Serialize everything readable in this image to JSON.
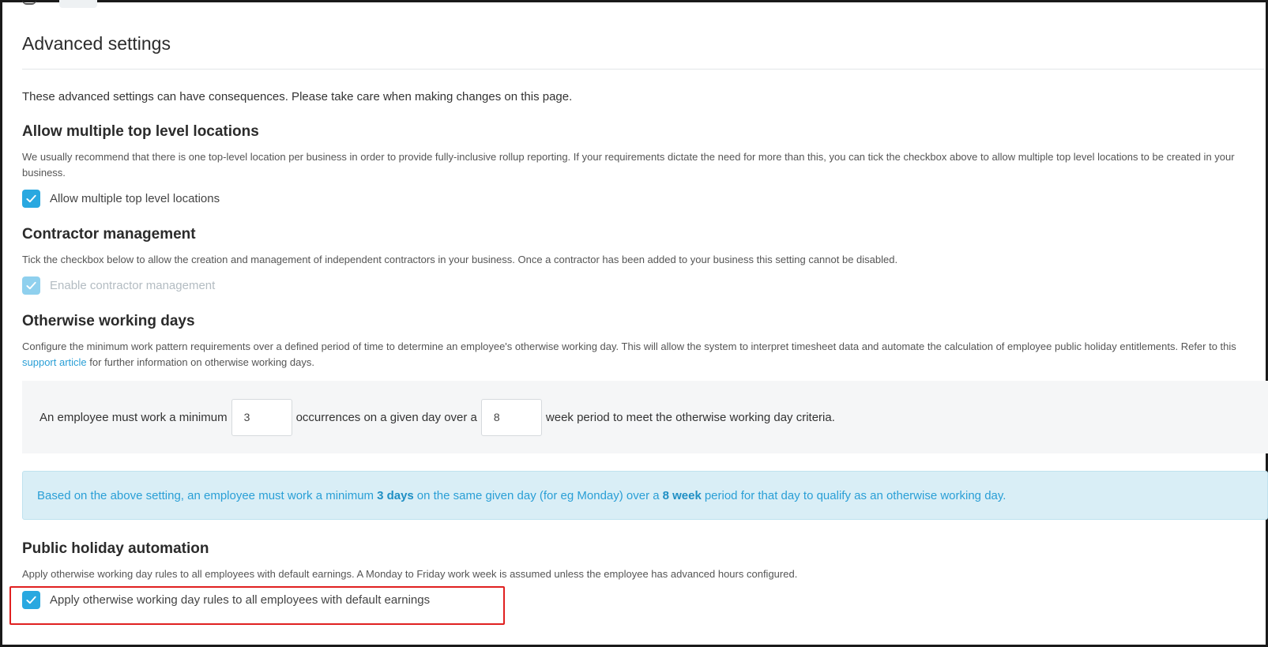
{
  "page": {
    "title": "Advanced settings",
    "warning": "These advanced settings can have consequences. Please take care when making changes on this page."
  },
  "sections": {
    "top_level": {
      "title": "Allow multiple top level locations",
      "description": "We usually recommend that there is one top-level location per business in order to provide fully-inclusive rollup reporting. If your requirements dictate the need for more than this, you can tick the checkbox above to allow multiple top level locations to be created in your business.",
      "checkbox_label": "Allow multiple top level locations",
      "checked": true
    },
    "contractor": {
      "title": "Contractor management",
      "description": "Tick the checkbox below to allow the creation and management of independent contractors in your business. Once a contractor has been added to your business this setting cannot be disabled.",
      "checkbox_label": "Enable contractor management",
      "checked": true,
      "disabled": true
    },
    "working_days": {
      "title": "Otherwise working days",
      "description_before_link": "Configure the minimum work pattern requirements over a defined period of time to determine an employee's otherwise working day. This will allow the system to interpret timesheet data and automate the calculation of employee public holiday entitlements. Refer to this",
      "link_text": "support article",
      "description_after_link": "for further information on otherwise working days.",
      "sentence_part1": "An employee must work a minimum",
      "min_occurrences": "3",
      "sentence_part2": "occurrences on a given day over a",
      "week_period": "8",
      "sentence_part3": "week period to meet the otherwise working day criteria.",
      "info_part1": "Based on the above setting, an employee must work a minimum",
      "info_bold1": "3 days",
      "info_part2": "on the same given day (for eg Monday) over a",
      "info_bold2": "8 week",
      "info_part3": "period for that day to qualify as an otherwise working day."
    },
    "public_holiday": {
      "title": "Public holiday automation",
      "description": "Apply otherwise working day rules to all employees with default earnings. A Monday to Friday work week is assumed unless the employee has advanced hours configured.",
      "checkbox_label": "Apply otherwise working day rules to all employees with default earnings",
      "checked": true
    }
  },
  "colors": {
    "accent": "#29a8e0",
    "info_background": "#d9eef6",
    "highlight": "#e02020"
  }
}
